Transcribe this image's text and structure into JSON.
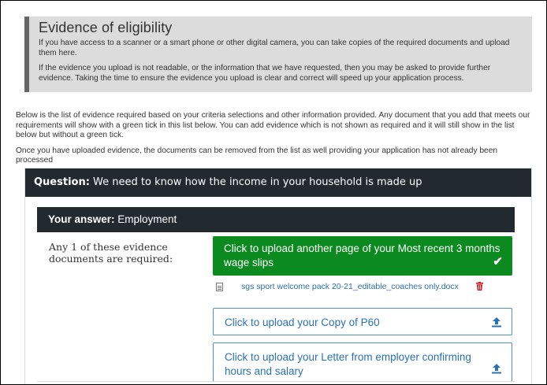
{
  "notice": {
    "title": "Evidence of eligibility",
    "p1": "If you have access to a scanner or a smart phone or other digital camera, you can take copies of the required documents and upload them here.",
    "p2": "If the evidence you upload is not readable, or the information that we have requested, then you may be asked to provide further evidence.  Taking the time to ensure the evidence you upload is clear and correct will speed up your application process."
  },
  "intro": {
    "p1": "Below is the list of evidence required based on your criteria selections and other information provided. Any document that you add that meets our requirements will show with a green tick in this list below. You can add evidence which is not shown as required and it will still show in the list below but without a green tick.",
    "p2": "Once you have uploaded evidence, the documents can be removed from the list as well providing your application has not already been processed"
  },
  "question": {
    "label": "Question:",
    "text": " We need to know how the income in your household is made up"
  },
  "answer": {
    "label": "Your answer:",
    "text": " Employment"
  },
  "requirement": "Any 1 of these evidence documents are required:",
  "uploaded_group": {
    "button_label": "Click to upload another page of your Most recent 3 months wage slips",
    "file_name": "sgs sport welcome pack 20-21_editable_coaches only.docx"
  },
  "upload_buttons": [
    {
      "label": "Click to upload your Copy of P60"
    },
    {
      "label": "Click to upload your Letter from employer confirming hours and salary"
    }
  ],
  "colors": {
    "dark_header": "#222a30",
    "success_green": "#0a8a1f",
    "link_blue": "#2a72b5",
    "delete_red": "#d9141c"
  },
  "icons": {
    "check": "check-icon",
    "document": "document-icon",
    "delete": "trash-icon",
    "upload": "upload-icon"
  }
}
